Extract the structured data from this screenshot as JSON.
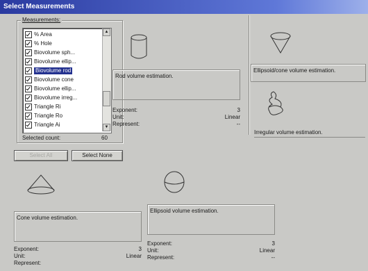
{
  "window": {
    "title": "Select Measurements"
  },
  "measurements": {
    "label": "Measurements:",
    "items": [
      {
        "label": "% Area",
        "checked": true,
        "selected": false
      },
      {
        "label": "% Hole",
        "checked": true,
        "selected": false
      },
      {
        "label": "Biovolume sph...",
        "checked": true,
        "selected": false
      },
      {
        "label": "Biovolume ellip...",
        "checked": true,
        "selected": false
      },
      {
        "label": "Biovolume rod",
        "checked": true,
        "selected": true
      },
      {
        "label": "Biovolume cone",
        "checked": true,
        "selected": false
      },
      {
        "label": "Biovolume ellip...",
        "checked": true,
        "selected": false
      },
      {
        "label": "Biovolume irreg...",
        "checked": true,
        "selected": false
      },
      {
        "label": "Triangle Ri",
        "checked": true,
        "selected": false
      },
      {
        "label": "Triangle Ro",
        "checked": true,
        "selected": false
      },
      {
        "label": "Triangle Ai",
        "checked": true,
        "selected": false
      }
    ],
    "selected_count_label": "Selected count:",
    "selected_count": "60"
  },
  "buttons": {
    "select_all": "Select All",
    "select_none": "Select None"
  },
  "panels": {
    "rod": {
      "icon": "cylinder-icon",
      "description": "Rod volume estimation.",
      "exponent_label": "Exponent:",
      "exponent": "3",
      "unit_label": "Unit:",
      "unit": "Linear",
      "represent_label": "Represent:",
      "represent": "--"
    },
    "ellipsoid_cone": {
      "icon": "ellipsoid-cone-icon",
      "description": "Ellipsoid/cone volume estimation."
    },
    "irregular": {
      "icon": "irregular-shape-icon",
      "description": "Irregular volume estimation."
    },
    "cone": {
      "icon": "cone-icon",
      "description": "Cone volume estimation.",
      "exponent_label": "Exponent:",
      "exponent": "3",
      "unit_label": "Unit:",
      "unit": "Linear",
      "represent_label": "Represent:"
    },
    "ellipsoid": {
      "icon": "ellipsoid-icon",
      "description": "Ellipsoid volume estimation.",
      "exponent_label": "Exponent:",
      "exponent": "3",
      "unit_label": "Unit:",
      "unit": "Linear",
      "represent_label": "Represent:",
      "represent": "--"
    }
  },
  "colors": {
    "titlebar": "#2a3aa0",
    "selection": "#23318f",
    "background": "#c9c9c6"
  }
}
